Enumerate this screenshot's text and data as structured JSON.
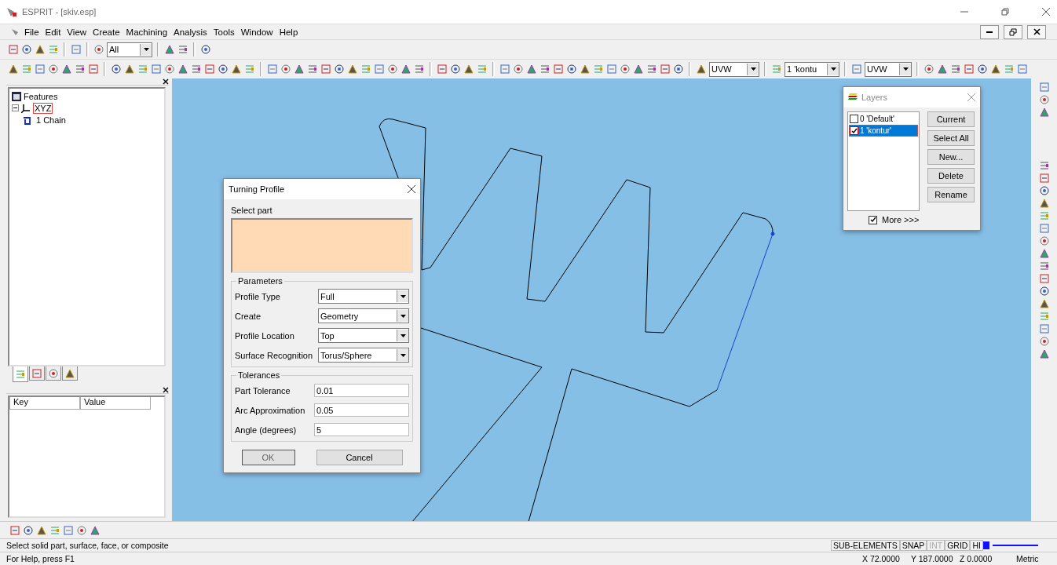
{
  "window": {
    "title": "ESPRIT - [skiv.esp]"
  },
  "menu": [
    {
      "label": "File"
    },
    {
      "label": "Edit"
    },
    {
      "label": "View"
    },
    {
      "label": "Create"
    },
    {
      "label": "Machining"
    },
    {
      "label": "Analysis"
    },
    {
      "label": "Tools"
    },
    {
      "label": "Window"
    },
    {
      "label": "Help"
    }
  ],
  "toolbar": {
    "filter": "All",
    "combos": [
      {
        "value": "UVW"
      },
      {
        "value": "1 'kontu"
      },
      {
        "value": "UVW"
      }
    ]
  },
  "feature_tree": {
    "title": "Features",
    "children": [
      {
        "label": "XYZ",
        "expanded": true,
        "selected": true,
        "children": [
          {
            "label": "1 Chain",
            "selected": false
          }
        ]
      }
    ]
  },
  "panel_tabs": [
    {
      "selected": true
    },
    {
      "selected": false
    },
    {
      "selected": false
    },
    {
      "selected": false
    }
  ],
  "properties": {
    "columns": [
      "Key",
      "Value"
    ]
  },
  "turning_profile": {
    "title": "Turning Profile",
    "select_label": "Select part",
    "parameters_title": "Parameters",
    "parameters": [
      {
        "label": "Profile Type",
        "value": "Full"
      },
      {
        "label": "Create",
        "value": "Geometry"
      },
      {
        "label": "Profile Location",
        "value": "Top"
      },
      {
        "label": "Surface Recognition",
        "value": "Torus/Sphere"
      }
    ],
    "tolerances_title": "Tolerances",
    "tolerances": [
      {
        "label": "Part Tolerance",
        "value": "0.01"
      },
      {
        "label": "Arc Approximation",
        "value": "0.05"
      },
      {
        "label": "Angle (degrees)",
        "value": "5"
      }
    ],
    "buttons": [
      {
        "label": "OK",
        "default": true
      },
      {
        "label": "Cancel",
        "default": false
      }
    ]
  },
  "layers": {
    "title": "Layers",
    "items": [
      {
        "label": "0 'Default'",
        "checked": false,
        "selected": false
      },
      {
        "label": "1 'kontur'",
        "checked": true,
        "selected": true
      }
    ],
    "buttons": [
      "Current",
      "Select All",
      "New...",
      "Delete",
      "Rename"
    ],
    "more": {
      "label": "More >>>",
      "checked": true
    }
  },
  "status_bar": {
    "message": "Select solid part, surface, face, or composite",
    "help": "For Help, press F1",
    "indicators": [
      {
        "label": "SUB-ELEMENTS",
        "disabled": false
      },
      {
        "label": "SNAP",
        "disabled": false
      },
      {
        "label": "INT",
        "disabled": true
      },
      {
        "label": "GRID",
        "disabled": false
      },
      {
        "label": "HI",
        "disabled": false
      }
    ],
    "coordinates": [
      "X 72.0000",
      "Y 187.0000",
      "Z 0.0000"
    ],
    "units": "Metric"
  }
}
